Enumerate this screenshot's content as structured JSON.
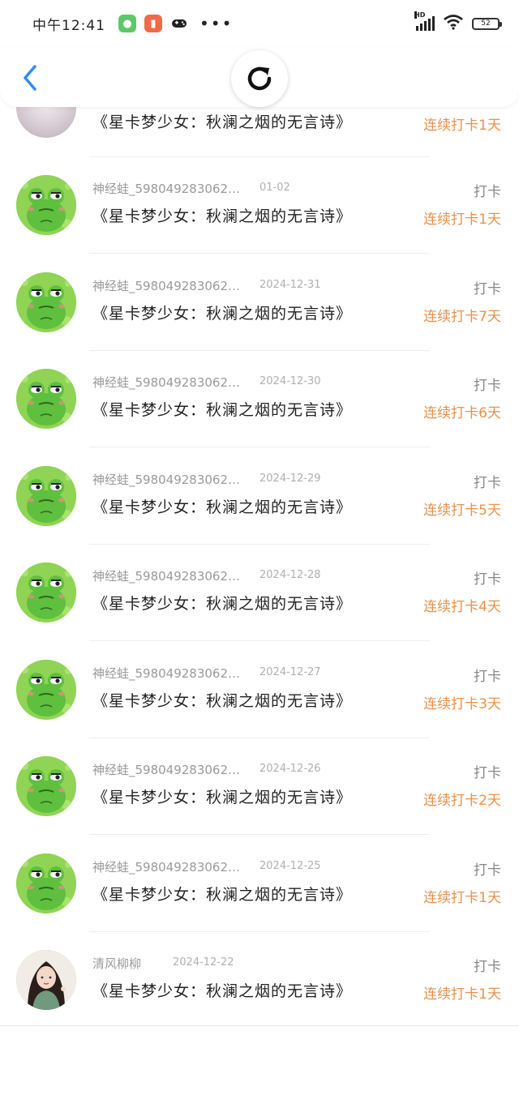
{
  "status_bar": {
    "time": "中午12:41",
    "more": "•••",
    "battery": "52",
    "hd": "HD"
  },
  "header": {
    "back_icon": "chevron-left-icon",
    "refresh_icon": "refresh-icon"
  },
  "colors": {
    "accent_blue": "#2f8ff0",
    "streak_orange": "#e8914c",
    "frog_green": "#8fd455"
  },
  "partial_row": {
    "title": "《星卡梦少女：秋澜之烟的无言诗》",
    "streak": "连续打卡1天"
  },
  "rows": [
    {
      "name": "神经蛙_598049283062…",
      "date": "01-02",
      "type": "打卡",
      "title": "《星卡梦少女：秋澜之烟的无言诗》",
      "streak": "连续打卡1天",
      "avatar": "frog"
    },
    {
      "name": "神经蛙_598049283062…",
      "date": "2024-12-31",
      "type": "打卡",
      "title": "《星卡梦少女：秋澜之烟的无言诗》",
      "streak": "连续打卡7天",
      "avatar": "frog"
    },
    {
      "name": "神经蛙_598049283062…",
      "date": "2024-12-30",
      "type": "打卡",
      "title": "《星卡梦少女：秋澜之烟的无言诗》",
      "streak": "连续打卡6天",
      "avatar": "frog"
    },
    {
      "name": "神经蛙_598049283062…",
      "date": "2024-12-29",
      "type": "打卡",
      "title": "《星卡梦少女：秋澜之烟的无言诗》",
      "streak": "连续打卡5天",
      "avatar": "frog"
    },
    {
      "name": "神经蛙_598049283062…",
      "date": "2024-12-28",
      "type": "打卡",
      "title": "《星卡梦少女：秋澜之烟的无言诗》",
      "streak": "连续打卡4天",
      "avatar": "frog"
    },
    {
      "name": "神经蛙_598049283062…",
      "date": "2024-12-27",
      "type": "打卡",
      "title": "《星卡梦少女：秋澜之烟的无言诗》",
      "streak": "连续打卡3天",
      "avatar": "frog"
    },
    {
      "name": "神经蛙_598049283062…",
      "date": "2024-12-26",
      "type": "打卡",
      "title": "《星卡梦少女：秋澜之烟的无言诗》",
      "streak": "连续打卡2天",
      "avatar": "frog"
    },
    {
      "name": "神经蛙_598049283062…",
      "date": "2024-12-25",
      "type": "打卡",
      "title": "《星卡梦少女：秋澜之烟的无言诗》",
      "streak": "连续打卡1天",
      "avatar": "frog"
    },
    {
      "name": "清风柳柳",
      "date": "2024-12-22",
      "type": "打卡",
      "title": "《星卡梦少女：秋澜之烟的无言诗》",
      "streak": "连续打卡1天",
      "avatar": "girl"
    }
  ]
}
